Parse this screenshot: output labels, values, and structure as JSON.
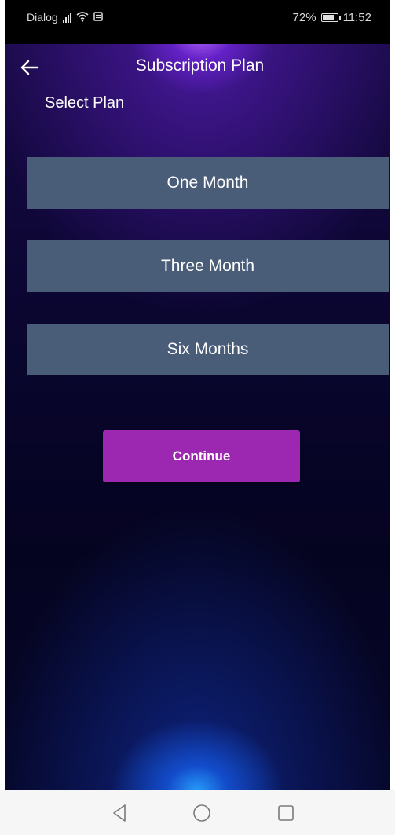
{
  "status_bar": {
    "carrier": "Dialog",
    "battery_percent": "72%",
    "battery_level": 0.72,
    "time": "11:52",
    "icons": [
      "signal-icon",
      "wifi-icon",
      "sim-icon",
      "battery-icon"
    ]
  },
  "app_bar": {
    "title": "Subscription Plan",
    "back_icon": "arrow-left-icon"
  },
  "content": {
    "section_label": "Select Plan",
    "plans": [
      {
        "label": "One Month"
      },
      {
        "label": "Three Month"
      },
      {
        "label": "Six Months"
      }
    ],
    "continue_label": "Continue"
  },
  "nav_bar": {
    "icons": [
      "triangle-back-icon",
      "circle-home-icon",
      "square-recent-icon"
    ]
  },
  "colors": {
    "plan_bg": "#4a5d78",
    "continue_bg": "#9c27b0",
    "background_dark": "#0a0630",
    "glow_top": "#a060ff",
    "glow_bottom": "#28a0ff"
  }
}
